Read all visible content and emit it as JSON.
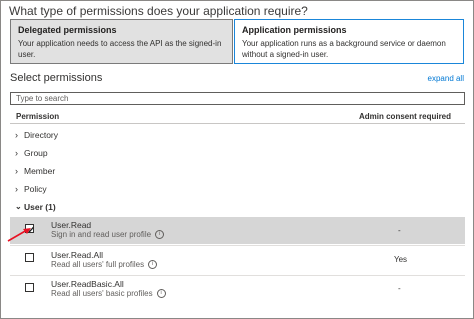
{
  "question": "What type of permissions does your application require?",
  "permission_types": [
    {
      "title": "Delegated permissions",
      "description": "Your application needs to access the API as the signed-in user.",
      "selected": true
    },
    {
      "title": "Application permissions",
      "description": "Your application runs as a background service or daemon without a signed-in user.",
      "selected": false
    }
  ],
  "select_permissions_label": "Select permissions",
  "expand_all_label": "expand all",
  "search": {
    "placeholder": "Type to search",
    "value": ""
  },
  "columns": {
    "permission": "Permission",
    "admin_consent": "Admin consent required"
  },
  "groups": [
    {
      "label": "Directory"
    },
    {
      "label": "Group"
    },
    {
      "label": "Member"
    },
    {
      "label": "Policy"
    }
  ],
  "expanded_group": {
    "label": "User (1)",
    "expanded": true
  },
  "permissions": [
    {
      "name": "User.Read",
      "description": "Sign in and read user profile",
      "admin_consent": "-",
      "checked": true,
      "highlighted": true
    },
    {
      "name": "User.Read.All",
      "description": "Read all users' full profiles",
      "admin_consent": "Yes",
      "checked": false,
      "highlighted": false
    },
    {
      "name": "User.ReadBasic.All",
      "description": "Read all users' basic profiles",
      "admin_consent": "-",
      "checked": false,
      "highlighted": false
    }
  ],
  "colors": {
    "accent": "#0078d4",
    "annotation_arrow": "#e81123",
    "selected_card_bg": "#e1e1e1",
    "highlight_row_bg": "#d6d6d6"
  },
  "icons": {
    "chevron": "chevron-right-icon",
    "info": "info-icon",
    "checkmark": "checkmark-icon"
  }
}
